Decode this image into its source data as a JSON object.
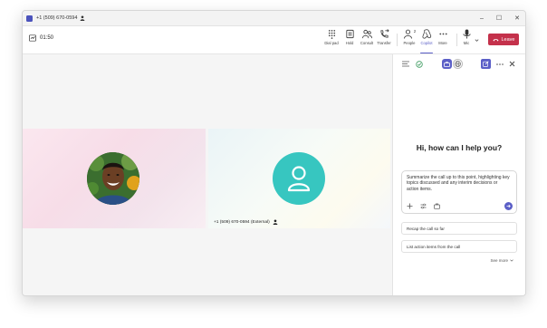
{
  "titlebar": {
    "number": "+1 (509) 670-0594",
    "controls": {
      "minimize": "–",
      "maximize": "☐",
      "close": "✕"
    }
  },
  "toolbar": {
    "timer": "01:50",
    "tools": [
      {
        "label": "Dial pad",
        "icon": "dialpad-icon"
      },
      {
        "label": "Hold",
        "icon": "hold-icon"
      },
      {
        "label": "Consult",
        "icon": "consult-icon"
      },
      {
        "label": "Transfer",
        "icon": "transfer-icon"
      },
      {
        "label": "People",
        "icon": "people-icon",
        "count": "2"
      },
      {
        "label": "Copilot",
        "icon": "copilot-icon",
        "active": true
      },
      {
        "label": "More",
        "icon": "more-icon"
      },
      {
        "label": "Mic",
        "icon": "mic-icon"
      }
    ],
    "leave_label": "Leave"
  },
  "stage": {
    "remote_label": "+1 (509) 670-0594 (External)"
  },
  "copilot": {
    "greeting": "Hi, how can I help you?",
    "prompt_text": "Summarize the call up to this point, highlighting key topics discussed and any interim decisions or action items.",
    "suggestions": [
      "Recap the call so far",
      "List action items from the call"
    ],
    "see_more": "See more"
  },
  "colors": {
    "accent": "#5b5fc7",
    "leave": "#c4314b",
    "avatar": "#37c6c0"
  }
}
